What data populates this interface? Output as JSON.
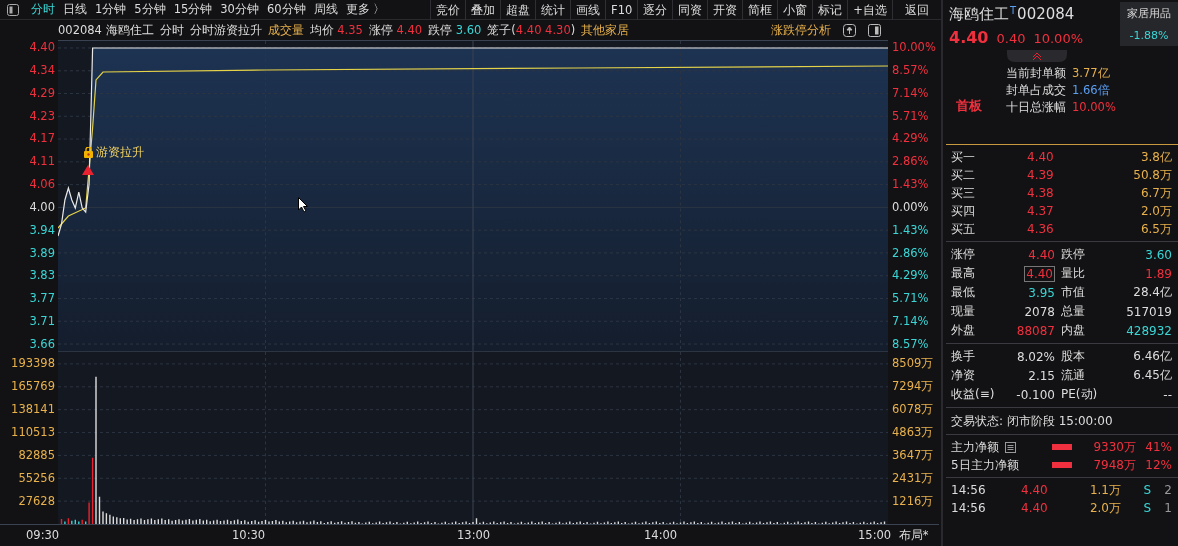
{
  "toolbar": {
    "periods": [
      {
        "label": "分时",
        "selected": true
      },
      {
        "label": "日线",
        "selected": false
      },
      {
        "label": "1分钟",
        "selected": false
      },
      {
        "label": "5分钟",
        "selected": false
      },
      {
        "label": "15分钟",
        "selected": false
      },
      {
        "label": "30分钟",
        "selected": false
      },
      {
        "label": "60分钟",
        "selected": false
      },
      {
        "label": "周线",
        "selected": false
      },
      {
        "label": "更多 〉",
        "selected": false
      }
    ],
    "buttons": [
      "竞价",
      "叠加",
      "超盘",
      "统计",
      "画线",
      "F10",
      "逐分",
      "同资",
      "开资",
      "简框",
      "小窗",
      "标记",
      "+自选",
      "返回"
    ]
  },
  "info_bar": {
    "code_name": "002084 海鸥住工",
    "mode": "分时",
    "indicator": "分时游资拉升",
    "volume_label": "成交量",
    "avg_label": "均价",
    "avg_value": "4.35",
    "limit_up_label": "涨停",
    "limit_up_value": "4.40",
    "limit_down_label": "跌停",
    "limit_down_value": "3.60",
    "cage_label": "笼子(",
    "cage_values": "4.40 4.30",
    "cage_close": ")",
    "sector": "其他家居",
    "analysis_link": "涨跌停分析"
  },
  "price_axis": [
    {
      "label": "4.40",
      "kind": "up"
    },
    {
      "label": "4.34",
      "kind": "up"
    },
    {
      "label": "4.29",
      "kind": "up"
    },
    {
      "label": "4.23",
      "kind": "up"
    },
    {
      "label": "4.17",
      "kind": "up"
    },
    {
      "label": "4.11",
      "kind": "up"
    },
    {
      "label": "4.06",
      "kind": "up"
    },
    {
      "label": "4.00",
      "kind": "flat"
    },
    {
      "label": "3.94",
      "kind": "down"
    },
    {
      "label": "3.89",
      "kind": "down"
    },
    {
      "label": "3.83",
      "kind": "down"
    },
    {
      "label": "3.77",
      "kind": "down"
    },
    {
      "label": "3.71",
      "kind": "down"
    },
    {
      "label": "3.66",
      "kind": "down"
    }
  ],
  "percent_axis": [
    {
      "label": "10.00%",
      "kind": "up"
    },
    {
      "label": "8.57%",
      "kind": "up"
    },
    {
      "label": "7.14%",
      "kind": "up"
    },
    {
      "label": "5.71%",
      "kind": "up"
    },
    {
      "label": "4.29%",
      "kind": "up"
    },
    {
      "label": "2.86%",
      "kind": "up"
    },
    {
      "label": "1.43%",
      "kind": "up"
    },
    {
      "label": "0.00%",
      "kind": "flat"
    },
    {
      "label": "1.43%",
      "kind": "down"
    },
    {
      "label": "2.86%",
      "kind": "down"
    },
    {
      "label": "4.29%",
      "kind": "down"
    },
    {
      "label": "5.71%",
      "kind": "down"
    },
    {
      "label": "7.14%",
      "kind": "down"
    },
    {
      "label": "8.57%",
      "kind": "down"
    }
  ],
  "volume_axis": [
    "193398",
    "165769",
    "138141",
    "110513",
    "82885",
    "55256",
    "27628"
  ],
  "amount_axis": [
    "8509万",
    "7294万",
    "6078万",
    "4863万",
    "3647万",
    "2431万",
    "1216万"
  ],
  "signal": {
    "label": "游资拉升"
  },
  "time_axis": [
    "09:30",
    "10:30",
    "13:00",
    "14:00",
    "15:00"
  ],
  "layout_button": "布局*",
  "quote": {
    "name": "海鸥住工",
    "tag": "T",
    "code": "002084",
    "price": "4.40",
    "change": "0.40",
    "change_pct": "10.00%",
    "sector": "家居用品",
    "sector_change": "-1.88%",
    "board": "首板",
    "details": [
      {
        "label": "当前封单额",
        "value": "3.77亿",
        "kind": "amount"
      },
      {
        "label": "封单占成交",
        "value": "1.66倍",
        "kind": "ratio"
      },
      {
        "label": "十日总涨幅",
        "value": "10.00%",
        "kind": "up"
      }
    ]
  },
  "order_book": [
    {
      "label": "买一",
      "price": "4.40",
      "volume": "3.8亿"
    },
    {
      "label": "买二",
      "price": "4.39",
      "volume": "50.8万"
    },
    {
      "label": "买三",
      "price": "4.38",
      "volume": "6.7万"
    },
    {
      "label": "买四",
      "price": "4.37",
      "volume": "2.0万"
    },
    {
      "label": "买五",
      "price": "4.36",
      "volume": "6.5万"
    }
  ],
  "stats": [
    [
      {
        "label": "涨停",
        "value": "4.40",
        "kind": "up"
      },
      {
        "label": "跌停",
        "value": "3.60",
        "kind": "down"
      }
    ],
    [
      {
        "label": "最高",
        "value": "4.40",
        "kind": "up",
        "boxed": true
      },
      {
        "label": "量比",
        "value": "1.89",
        "kind": "up"
      }
    ],
    [
      {
        "label": "最低",
        "value": "3.95",
        "kind": "down"
      },
      {
        "label": "市值",
        "value": "28.4亿",
        "kind": "flat"
      }
    ],
    [
      {
        "label": "现量",
        "value": "2078",
        "kind": "flat"
      },
      {
        "label": "总量",
        "value": "517019",
        "kind": "flat"
      }
    ],
    [
      {
        "label": "外盘",
        "value": "88087",
        "kind": "up"
      },
      {
        "label": "内盘",
        "value": "428932",
        "kind": "down"
      }
    ]
  ],
  "stats2": [
    [
      {
        "label": "换手",
        "value": "8.02%"
      },
      {
        "label": "股本",
        "value": "6.46亿"
      }
    ],
    [
      {
        "label": "净资",
        "value": "2.15"
      },
      {
        "label": "流通",
        "value": "6.45亿"
      }
    ],
    [
      {
        "label": "收益(≡)",
        "value": "-0.100"
      },
      {
        "label": "PE(动)",
        "value": "--"
      }
    ]
  ],
  "trade_status": "交易状态: 闭市阶段 15:00:00",
  "money_flow": [
    {
      "label": "主力净额",
      "has_menu": true,
      "amount": "9330万",
      "pct": "41%"
    },
    {
      "label": "5日主力净额",
      "has_menu": false,
      "amount": "7948万",
      "pct": "12%"
    }
  ],
  "ticks": [
    {
      "time": "14:56",
      "price": "4.40",
      "volume": "1.1万",
      "side": "S",
      "count": "2"
    },
    {
      "time": "14:56",
      "price": "4.40",
      "volume": "2.0万",
      "side": "S",
      "count": "1"
    }
  ]
}
